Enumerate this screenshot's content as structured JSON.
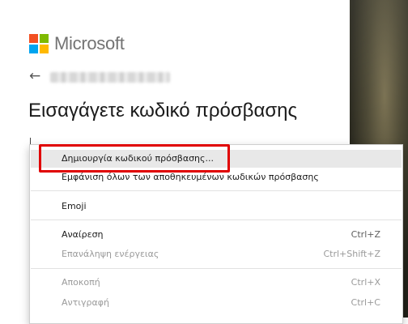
{
  "brand": {
    "name": "Microsoft"
  },
  "page": {
    "back_glyph": "←",
    "title": "Εισαγάγετε κωδικό πρόσβασης"
  },
  "context_menu": {
    "items": [
      {
        "label": "Δημιουργία κωδικού πρόσβασης...",
        "shortcut": "",
        "enabled": true,
        "highlighted": true
      },
      {
        "label": "Εμφάνιση όλων των αποθηκευμένων κωδικών πρόσβασης",
        "shortcut": "",
        "enabled": true
      },
      {
        "label": "Emoji",
        "shortcut": "",
        "enabled": true
      },
      {
        "label": "Αναίρεση",
        "shortcut": "Ctrl+Z",
        "enabled": true
      },
      {
        "label": "Επανάληψη ενέργειας",
        "shortcut": "Ctrl+Shift+Z",
        "enabled": false
      },
      {
        "label": "Αποκοπή",
        "shortcut": "Ctrl+X",
        "enabled": false
      },
      {
        "label": "Αντιγραφή",
        "shortcut": "Ctrl+C",
        "enabled": false
      }
    ]
  },
  "colors": {
    "highlight_border": "#e00000",
    "ms_red": "#f25022",
    "ms_green": "#7fba00",
    "ms_blue": "#00a4ef",
    "ms_yellow": "#ffb900"
  }
}
